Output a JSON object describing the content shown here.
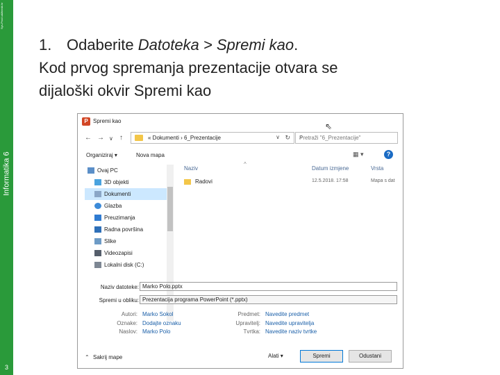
{
  "sidebar": {
    "top_text": "Sys-Prod udžbenik.hr",
    "label": "Informatika 6",
    "page_number": "3",
    "color": "#2a9a3a"
  },
  "slide": {
    "step_number": "1.",
    "line1_prefix": "Odaberite ",
    "line1_italic": "Datoteka > Spremi kao",
    "line1_suffix": ".",
    "line2": "Kod prvog spremanja prezentacije otvara se",
    "line3": "dijaloški okvir Spremi kao"
  },
  "dialog": {
    "title": "Spremi kao",
    "app_icon_letter": "P",
    "nav_back": "←",
    "nav_forward": "→",
    "nav_recent": "∨",
    "nav_up": "↑",
    "breadcrumb": "«  Dokumenti  ›  6_Prezentacije",
    "refresh": "↻",
    "search_placeholder": "Pretraži \"6_Prezentacije\"",
    "toolbar": {
      "organize": "Organiziraj ▾",
      "new_folder": "Nova mapa",
      "view": "▦ ▾",
      "help": "?"
    },
    "nav_items": [
      {
        "label": "Ovaj PC",
        "icon": "computer-icon"
      },
      {
        "label": "3D objekti",
        "icon": "cube-icon"
      },
      {
        "label": "Dokumenti",
        "icon": "documents-icon"
      },
      {
        "label": "Glazba",
        "icon": "music-icon"
      },
      {
        "label": "Preuzimanja",
        "icon": "download-icon"
      },
      {
        "label": "Radna površina",
        "icon": "desktop-icon"
      },
      {
        "label": "Slike",
        "icon": "pictures-icon"
      },
      {
        "label": "Videozapisi",
        "icon": "video-icon"
      },
      {
        "label": "Lokalni disk (C:)",
        "icon": "drive-icon"
      }
    ],
    "columns": {
      "name": "Naziv",
      "date": "Datum izmjene",
      "type": "Vrsta",
      "sort_indicator": "^"
    },
    "files": [
      {
        "name": "Radovi",
        "date": "12.5.2018. 17:58",
        "type": "Mapa s dat"
      }
    ],
    "form": {
      "filename_label": "Naziv datoteke:",
      "filename_value": "Marko Polo.pptx",
      "filetype_label": "Spremi u obliku:",
      "filetype_value": "Prezentacija programa PowerPoint (*.pptx)"
    },
    "meta": {
      "author_label": "Autori:",
      "author_value": "Marko Sokol",
      "tags_label": "Oznake:",
      "tags_value": "Dodajte oznaku",
      "title_label": "Naslov:",
      "title_value": "Marko Polo",
      "subject_label": "Predmet:",
      "subject_value": "Navedite predmet",
      "manager_label": "Upravitelj:",
      "manager_value": "Navedite upravitelja",
      "company_label": "Tvrtka:",
      "company_value": "Navedite naziv tvrtke"
    },
    "footer": {
      "hide_folders": "Sakrij mape",
      "tools": "Alati  ▾",
      "save": "Spremi",
      "cancel": "Odustani"
    }
  }
}
